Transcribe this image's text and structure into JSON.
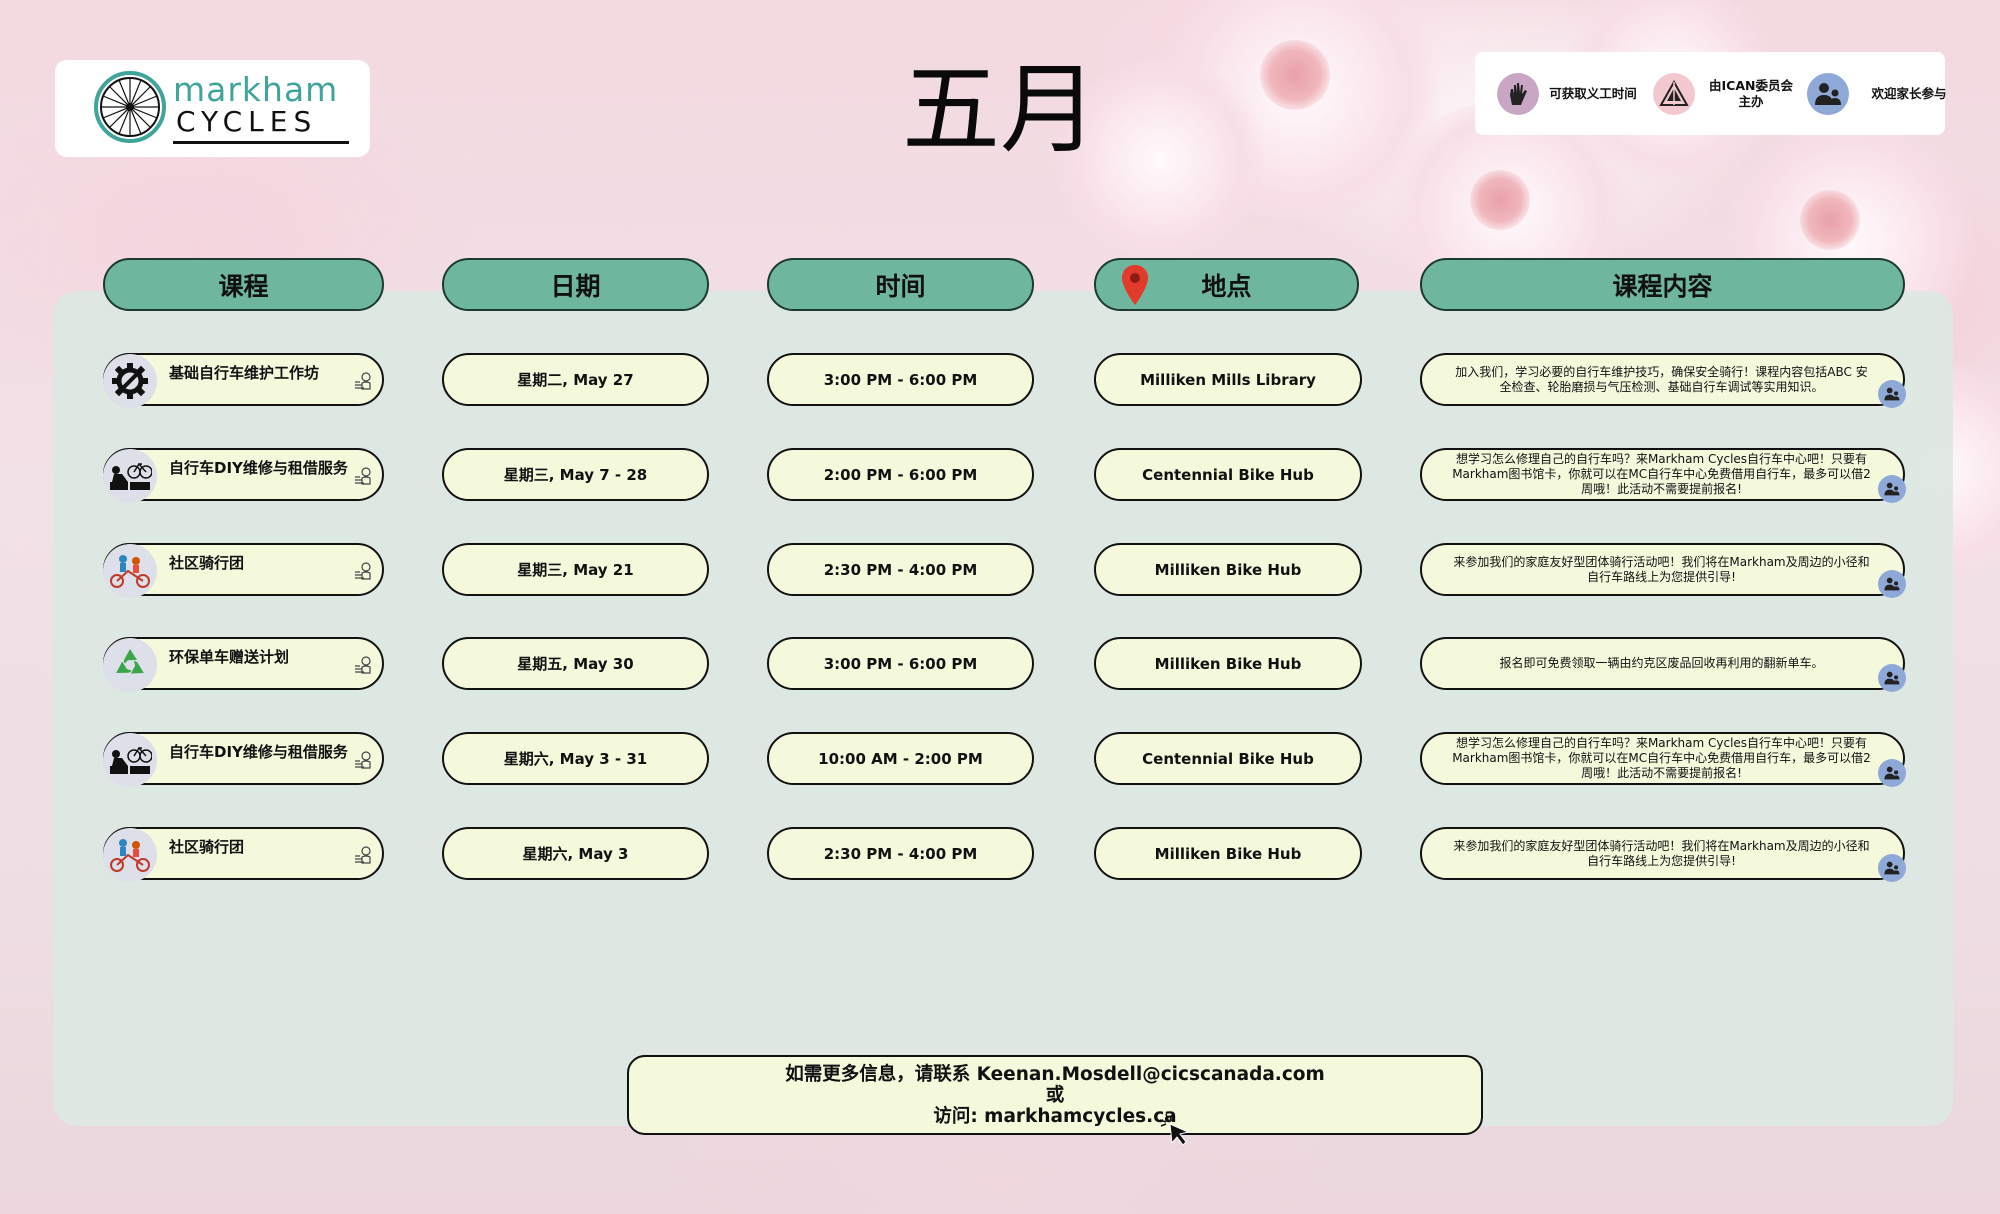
{
  "logo": {
    "line1": "markham",
    "line2": "CYCLES"
  },
  "title": "五月",
  "legend": [
    {
      "icon": "hand-icon",
      "label": "可获取义工时间",
      "color": "#c9a6c4"
    },
    {
      "icon": "ican-logo-icon",
      "label": "由ICAN委员会主办",
      "color": "#f3c9cf"
    },
    {
      "icon": "parent-child-icon",
      "label": "欢迎家长参与",
      "color": "#8ea9d8"
    }
  ],
  "headers": {
    "course": "课程",
    "date": "日期",
    "time": "时间",
    "location": "地点",
    "content": "课程内容"
  },
  "rows": [
    {
      "icon": "gear-wrench-icon",
      "course": "基础自行车维护工作坊",
      "date": "星期二, May  27",
      "time": "3:00 PM - 6:00 PM",
      "location": "Milliken Mills Library",
      "content": "加入我们，学习必要的自行车维护技巧，确保安全骑行！课程内容包括ABC 安全检查、轮胎磨损与气压检测、基础自行车调试等实用知识。"
    },
    {
      "icon": "bike-repair-icon",
      "course": "自行车DIY维修与租借服务",
      "date": "星期三, May  7 - 28",
      "time": "2:00 PM - 6:00 PM",
      "location": "Centennial Bike Hub",
      "content": "想学习怎么修理自己的自行车吗？来Markham Cycles自行车中心吧！只要有Markham图书馆卡，你就可以在MC自行车中心免费借用自行车，最多可以借2周哦！此活动不需要提前报名!"
    },
    {
      "icon": "family-ride-icon",
      "course": "社区骑行团",
      "date": "星期三, May  21",
      "time": "2:30 PM - 4:00 PM",
      "location": "Milliken Bike Hub",
      "content": "来参加我们的家庭友好型团体骑行活动吧！我们将在Markham及周边的小径和自行车路线上为您提供引导!"
    },
    {
      "icon": "recycle-icon",
      "course": "环保单车赠送计划",
      "date": "星期五, May  30",
      "time": "3:00 PM - 6:00 PM",
      "location": "Milliken Bike Hub",
      "content": "报名即可免费领取一辆由约克区废品回收再利用的翻新单车。"
    },
    {
      "icon": "bike-repair-icon",
      "course": "自行车DIY维修与租借服务",
      "date": "星期六, May 3 - 31",
      "time": "10:00 AM - 2:00 PM",
      "location": "Centennial Bike Hub",
      "content": "想学习怎么修理自己的自行车吗？来Markham Cycles自行车中心吧！只要有Markham图书馆卡，你就可以在MC自行车中心免费借用自行车，最多可以借2周哦！此活动不需要提前报名!"
    },
    {
      "icon": "family-ride-icon",
      "course": "社区骑行团",
      "date": "星期六, May 3",
      "time": "2:30 PM - 4:00 PM",
      "location": "Milliken Bike Hub",
      "content": "来参加我们的家庭友好型团体骑行活动吧！我们将在Markham及周边的小径和自行车路线上为您提供引导!"
    }
  ],
  "footer": {
    "line1": "如需更多信息，请联系 Keenan.Mosdell@cicscanada.com",
    "line2": "或",
    "line3": "访问: markhamcycles.ca"
  }
}
